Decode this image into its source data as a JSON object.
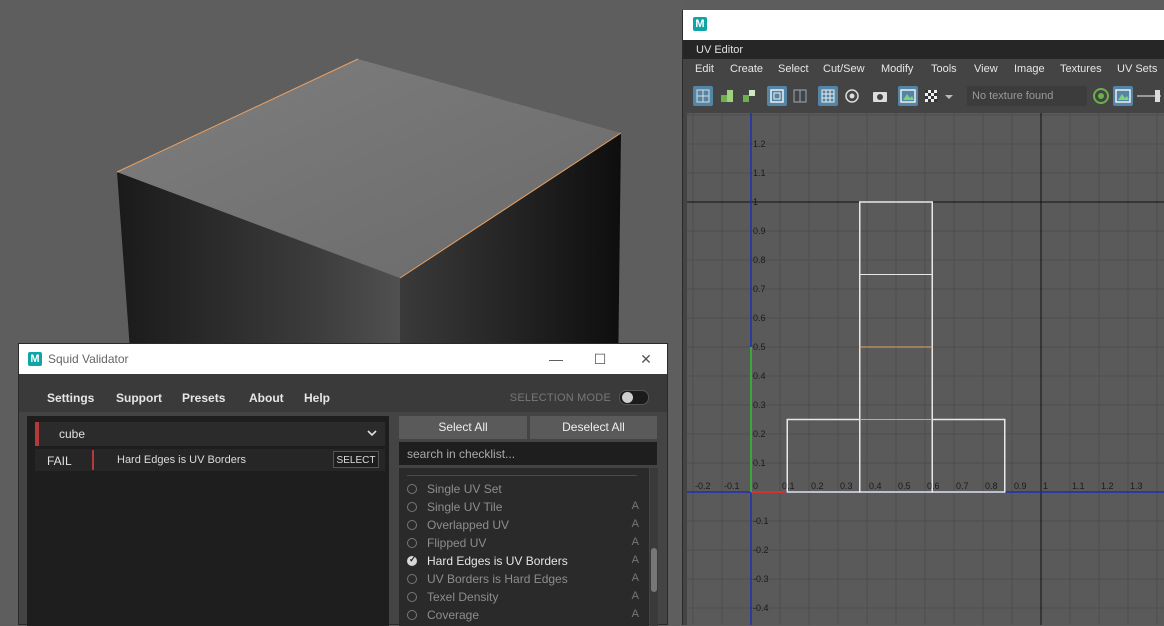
{
  "squid_validator": {
    "window_title": "Squid Validator",
    "menu": [
      "Settings",
      "Support",
      "Presets",
      "About",
      "Help"
    ],
    "selection_mode_label": "SELECTION MODE",
    "object_name": "cube",
    "result": {
      "status": "FAIL",
      "check": "Hard Edges is UV Borders",
      "button": "SELECT"
    },
    "select_all_label": "Select All",
    "deselect_all_label": "Deselect All",
    "search_placeholder": "search in checklist...",
    "checklist": [
      {
        "label": "Single UV Set",
        "flag": "",
        "checked": false
      },
      {
        "label": "Single UV Tile",
        "flag": "A",
        "checked": false
      },
      {
        "label": "Overlapped UV",
        "flag": "A",
        "checked": false
      },
      {
        "label": "Flipped UV",
        "flag": "A",
        "checked": false
      },
      {
        "label": "Hard Edges is UV Borders",
        "flag": "A",
        "checked": true
      },
      {
        "label": "UV Borders is Hard Edges",
        "flag": "A",
        "checked": false
      },
      {
        "label": "Texel Density",
        "flag": "A",
        "checked": false
      },
      {
        "label": "Coverage",
        "flag": "A",
        "checked": false
      }
    ]
  },
  "uv_editor": {
    "panel_title": "UV Editor",
    "menu": [
      "Edit",
      "Create",
      "Select",
      "Cut/Sew",
      "Modify",
      "Tools",
      "View",
      "Image",
      "Textures",
      "UV Sets"
    ],
    "texture_field": "No texture found",
    "grid": {
      "x_ticks": [
        "-0.2",
        "-0.1",
        "0",
        "0.1",
        "0.2",
        "0.3",
        "0.4",
        "0.5",
        "0.6",
        "0.7",
        "0.8",
        "0.9",
        "1",
        "1.1",
        "1.2",
        "1.3"
      ],
      "y_ticks": [
        "1.2",
        "1.1",
        "1",
        "0.9",
        "0.8",
        "0.7",
        "0.6",
        "0.5",
        "0.4",
        "0.3",
        "0.2",
        "0.1",
        "-0.1",
        "-0.2",
        "-0.3",
        "-0.4"
      ]
    }
  },
  "icons": [
    "maya-logo-icon",
    "minimize-icon",
    "maximize-icon",
    "close-icon",
    "chevron-down-icon",
    "uv-grid-icon",
    "checker-icon",
    "camera-icon",
    "image-icon",
    "rgb-icon"
  ],
  "colors": {
    "fail_accent": "#b23a3a",
    "uv_shell": "#e8e8e8",
    "hard_edge": "#e8a064",
    "selection_blue": "#5285a6"
  }
}
